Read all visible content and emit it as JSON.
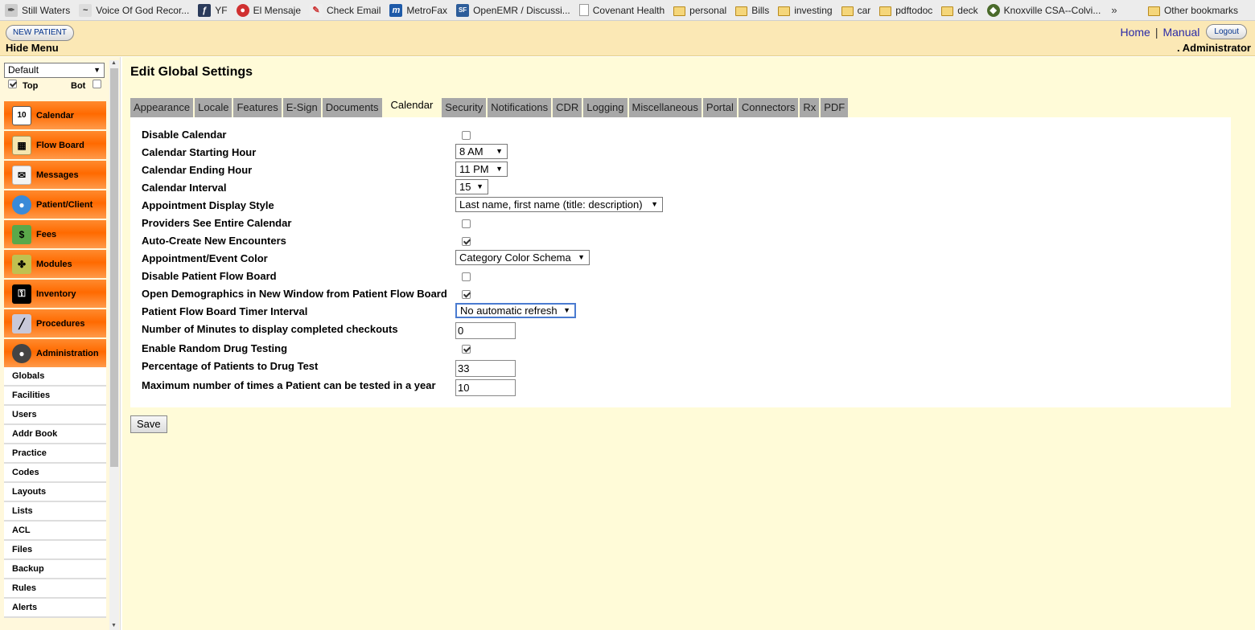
{
  "bookmarks": {
    "items": [
      {
        "label": "Still Waters",
        "icon": "feather-icon"
      },
      {
        "label": "Voice Of God Recor...",
        "icon": "dove-icon"
      },
      {
        "label": "YF",
        "icon": "yf-icon"
      },
      {
        "label": "El Mensaje",
        "icon": "red-drop-icon"
      },
      {
        "label": "Check Email",
        "icon": "email-icon"
      },
      {
        "label": "MetroFax",
        "icon": "metrofax-icon"
      },
      {
        "label": "OpenEMR / Discussi...",
        "icon": "sourceforge-icon"
      },
      {
        "label": "Covenant Health",
        "icon": "page-icon"
      },
      {
        "label": "personal",
        "icon": "folder-icon"
      },
      {
        "label": "Bills",
        "icon": "folder-icon"
      },
      {
        "label": "investing",
        "icon": "folder-icon"
      },
      {
        "label": "car",
        "icon": "folder-icon"
      },
      {
        "label": "pdftodoc",
        "icon": "folder-icon"
      },
      {
        "label": "deck",
        "icon": "folder-icon"
      },
      {
        "label": "Knoxville CSA--Colvi...",
        "icon": "knoxville-icon"
      }
    ],
    "overflow": "»",
    "other": "Other bookmarks"
  },
  "header": {
    "new_patient": "NEW PATIENT",
    "hide_menu": "Hide Menu",
    "home": "Home",
    "separator": "|",
    "manual": "Manual",
    "logout": "Logout",
    "user": ". Administrator"
  },
  "sidebar": {
    "layout_select": "Default",
    "top_label": "Top",
    "bot_label": "Bot",
    "top_checked": true,
    "bot_checked": false,
    "menu": [
      {
        "label": "Calendar",
        "icon": "calendar-icon"
      },
      {
        "label": "Flow Board",
        "icon": "flow-board-icon"
      },
      {
        "label": "Messages",
        "icon": "envelope-icon"
      },
      {
        "label": "Patient/Client",
        "icon": "person-icon"
      },
      {
        "label": "Fees",
        "icon": "money-icon"
      },
      {
        "label": "Modules",
        "icon": "puzzle-icon"
      },
      {
        "label": "Inventory",
        "icon": "key-icon"
      },
      {
        "label": "Procedures",
        "icon": "syringe-icon"
      },
      {
        "label": "Administration",
        "icon": "admin-person-icon"
      }
    ],
    "submenu": [
      "Globals",
      "Facilities",
      "Users",
      "Addr Book",
      "Practice",
      "Codes",
      "Layouts",
      "Lists",
      "ACL",
      "Files",
      "Backup",
      "Rules",
      "Alerts"
    ]
  },
  "main": {
    "title": "Edit Global Settings",
    "tabs": [
      "Appearance",
      "Locale",
      "Features",
      "E-Sign",
      "Documents",
      "Calendar",
      "Security",
      "Notifications",
      "CDR",
      "Logging",
      "Miscellaneous",
      "Portal",
      "Connectors",
      "Rx",
      "PDF"
    ],
    "active_tab": "Calendar",
    "settings": [
      {
        "label": "Disable Calendar",
        "type": "checkbox",
        "checked": false
      },
      {
        "label": "Calendar Starting Hour",
        "type": "select",
        "value": "8 AM"
      },
      {
        "label": "Calendar Ending Hour",
        "type": "select",
        "value": "11 PM"
      },
      {
        "label": "Calendar Interval",
        "type": "select",
        "value": "15"
      },
      {
        "label": "Appointment Display Style",
        "type": "select",
        "value": "Last name, first name (title: description)"
      },
      {
        "label": "Providers See Entire Calendar",
        "type": "checkbox",
        "checked": false
      },
      {
        "label": "Auto-Create New Encounters",
        "type": "checkbox",
        "checked": true
      },
      {
        "label": "Appointment/Event Color",
        "type": "select",
        "value": "Category Color Schema"
      },
      {
        "label": "Disable Patient Flow Board",
        "type": "checkbox",
        "checked": false
      },
      {
        "label": "Open Demographics in New Window from Patient Flow Board",
        "type": "checkbox",
        "checked": true
      },
      {
        "label": "Patient Flow Board Timer Interval",
        "type": "select",
        "value": "No automatic refresh"
      },
      {
        "label": "Number of Minutes to display completed checkouts",
        "type": "text",
        "value": "0"
      },
      {
        "label": "Enable Random Drug Testing",
        "type": "checkbox",
        "checked": true
      },
      {
        "label": "Percentage of Patients to Drug Test",
        "type": "text",
        "value": "33"
      },
      {
        "label": "Maximum number of times a Patient can be tested in a year",
        "type": "text",
        "value": "10"
      }
    ],
    "save": "Save"
  },
  "colors": {
    "header_bg": "#fbe8b5",
    "content_bg": "#fffbd8",
    "menu_orange": "#ff6a00",
    "tab_gray": "#a8a8a8",
    "link_blue": "#2a2aa8"
  }
}
